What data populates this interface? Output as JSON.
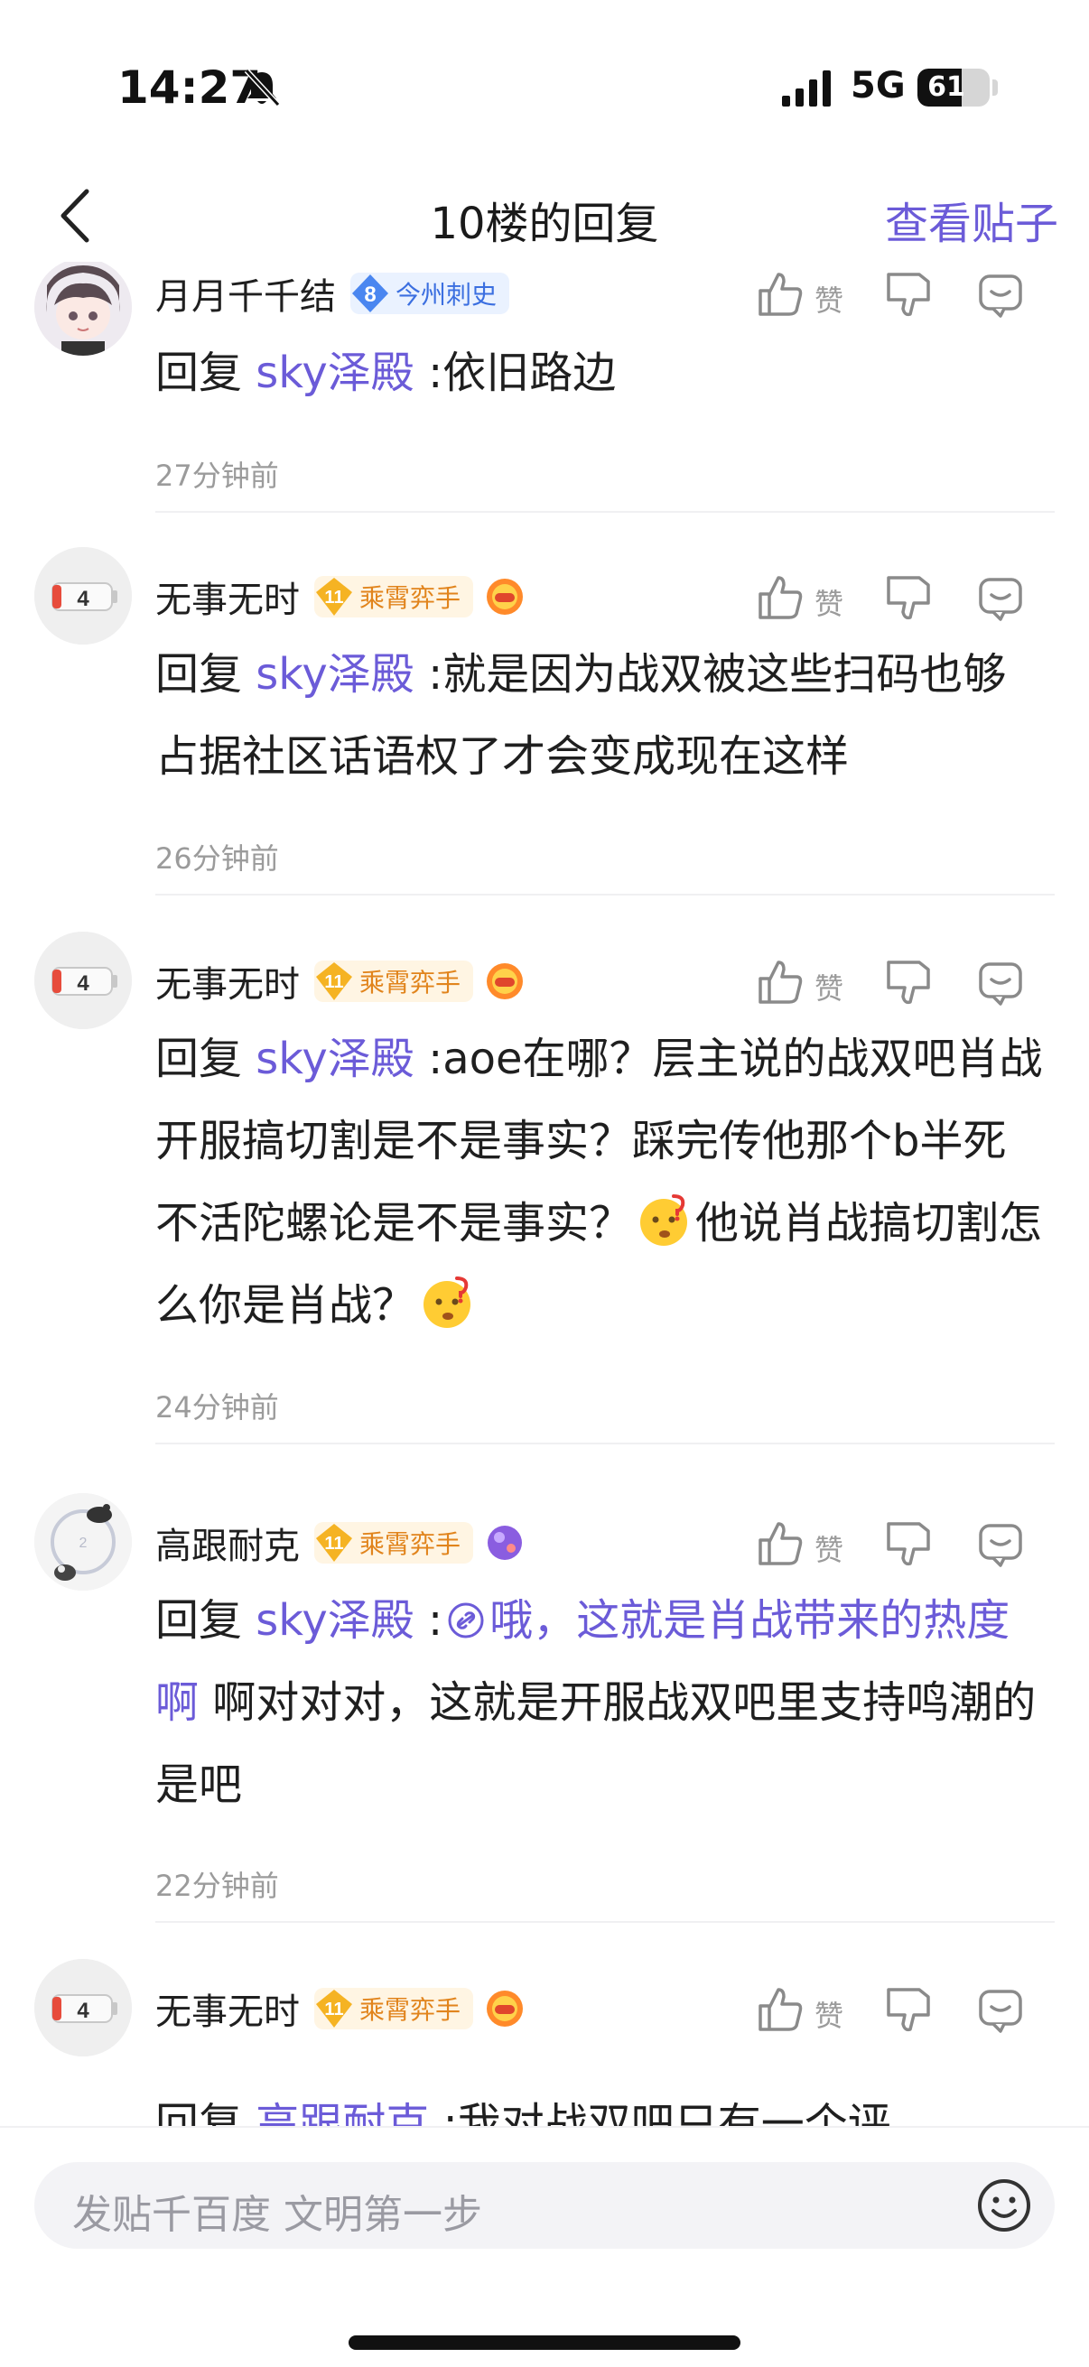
{
  "status": {
    "time": "14:27",
    "network": "5G",
    "battery": "61",
    "battery_level": 0.61
  },
  "nav": {
    "title": "10楼的回复",
    "view_post": "查看贴子"
  },
  "like_label": "赞",
  "comments": [
    {
      "username": "月月千千结",
      "badge_level": "8",
      "badge_title": "今州刺史",
      "badge_color": "blue",
      "reply_prefix": "回复",
      "reply_to": "sky泽殿",
      "text": ":依旧路边",
      "time": "27分钟前"
    },
    {
      "username": "无事无时",
      "avatar_text": "4",
      "badge_level": "11",
      "badge_title": "乘霄弈手",
      "badge_color": "gold",
      "reply_prefix": "回复",
      "reply_to": "sky泽殿",
      "text": ":就是因为战双被这些扫码也够占据社区话语权了才会变成现在这样",
      "time": "26分钟前"
    },
    {
      "username": "无事无时",
      "avatar_text": "4",
      "badge_level": "11",
      "badge_title": "乘霄弈手",
      "badge_color": "gold",
      "reply_prefix": "回复",
      "reply_to": "sky泽殿",
      "text_1": ":aoe在哪？层主说的战双吧肖战开服搞切割是不是事实？踩完传他那个b半死不活陀螺论是不是事实？",
      "text_2": "他说肖战搞切割怎么你是肖战？",
      "emoji": "thinking-face",
      "time": "24分钟前"
    },
    {
      "username": "高跟耐克",
      "badge_level": "11",
      "badge_title": "乘霄弈手",
      "badge_color": "gold",
      "reply_prefix": "回复",
      "reply_to": "sky泽殿",
      "link_text": "哦，这就是肖战带来的热度啊",
      "text": " 啊对对对，这就是开服战双吧里支持鸣潮的是吧",
      "time": "22分钟前"
    },
    {
      "username": "无事无时",
      "avatar_text": "4",
      "badge_level": "11",
      "badge_title": "乘霄弈手",
      "badge_color": "gold",
      "reply_prefix": "回复",
      "reply_to": "高跟耐克",
      "text": ":我对战双吧只有一个评"
    }
  ],
  "input": {
    "placeholder": "发贴千百度 文明第一步"
  },
  "colors": {
    "accent": "#6b5bd8",
    "muted": "#9b9b9b",
    "gold": "#e1841c",
    "blue": "#3b6fe0"
  }
}
